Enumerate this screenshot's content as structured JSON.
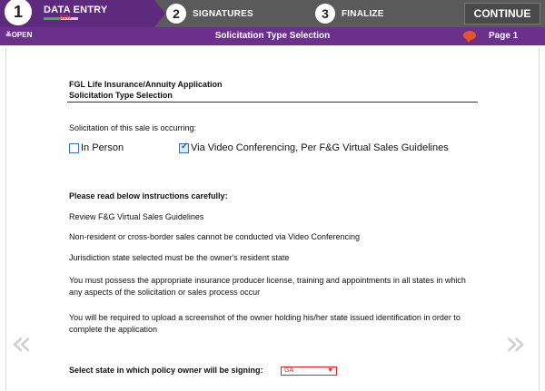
{
  "steps": [
    {
      "number": "1",
      "label": "DATA ENTRY",
      "progress_percent": "51%"
    },
    {
      "number": "2",
      "label": "SIGNATURES"
    },
    {
      "number": "3",
      "label": "FINALIZE"
    }
  ],
  "continue_label": "CONTINUE",
  "subbar": {
    "open_label": "OPEN",
    "title": "Solicitation Type Selection",
    "page_label": "Page 1"
  },
  "form": {
    "title_line1": "FGL Life Insurance/Annuity Application",
    "title_line2": "Solicitation Type Selection",
    "question": "Solicitation of this sale is occurring:",
    "options": [
      {
        "label": "In Person",
        "checked": false
      },
      {
        "label": "Via Video Conferencing, Per F&G Virtual Sales Guidelines",
        "checked": true
      }
    ],
    "instructions_heading": "Please read below instructions carefully:",
    "instructions": [
      "Review F&G Virtual Sales Guidelines",
      "Non-resident or cross-border sales cannot be conducted via Video Conferencing",
      "Jurisdiction state selected must be the owner's resident state",
      "You must possess the appropriate insurance producer license, training and appointments in all states in which any aspects of the solicitation or sales process occur",
      "You will be required to upload a screenshot of the owner holding his/her state issued identification in order to complete the application"
    ],
    "state_label": "Select state in which policy owner will be signing:",
    "state_value": "GA"
  },
  "nav": {
    "prev": "«",
    "next": "»"
  },
  "colors": {
    "purple": "#6b2f8c",
    "accent_green": "#3fb24a",
    "chat_orange": "#e8532b"
  },
  "icons": [
    "chevron-double-down-icon",
    "chat-icon",
    "checkbox-icon",
    "chevron-down-icon"
  ]
}
